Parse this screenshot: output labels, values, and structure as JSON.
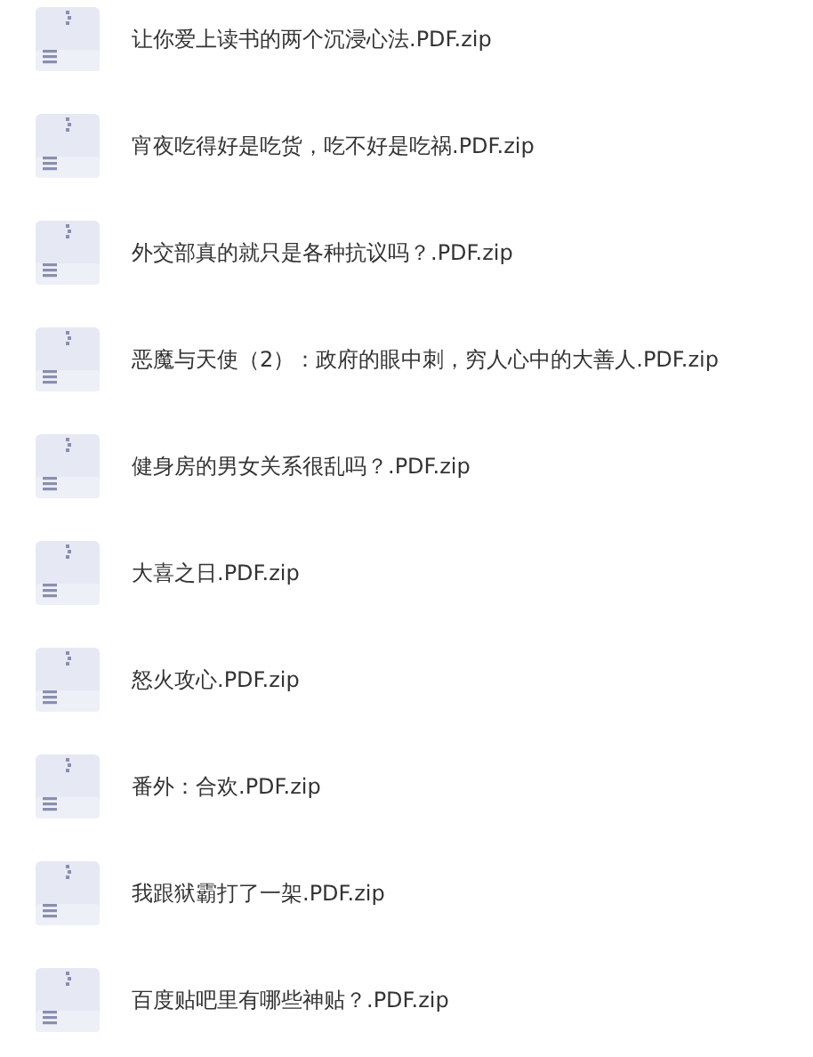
{
  "files": [
    {
      "name": "让你爱上读书的两个沉浸心法.PDF.zip"
    },
    {
      "name": "宵夜吃得好是吃货，吃不好是吃祸.PDF.zip"
    },
    {
      "name": "外交部真的就只是各种抗议吗？.PDF.zip"
    },
    {
      "name": "恶魔与天使（2）：政府的眼中刺，穷人心中的大善人.PDF.zip"
    },
    {
      "name": "健身房的男女关系很乱吗？.PDF.zip"
    },
    {
      "name": "大喜之日.PDF.zip"
    },
    {
      "name": "怒火攻心.PDF.zip"
    },
    {
      "name": "番外：合欢.PDF.zip"
    },
    {
      "name": "我跟狱霸打了一架.PDF.zip"
    },
    {
      "name": "百度贴吧里有哪些神贴？.PDF.zip"
    }
  ]
}
